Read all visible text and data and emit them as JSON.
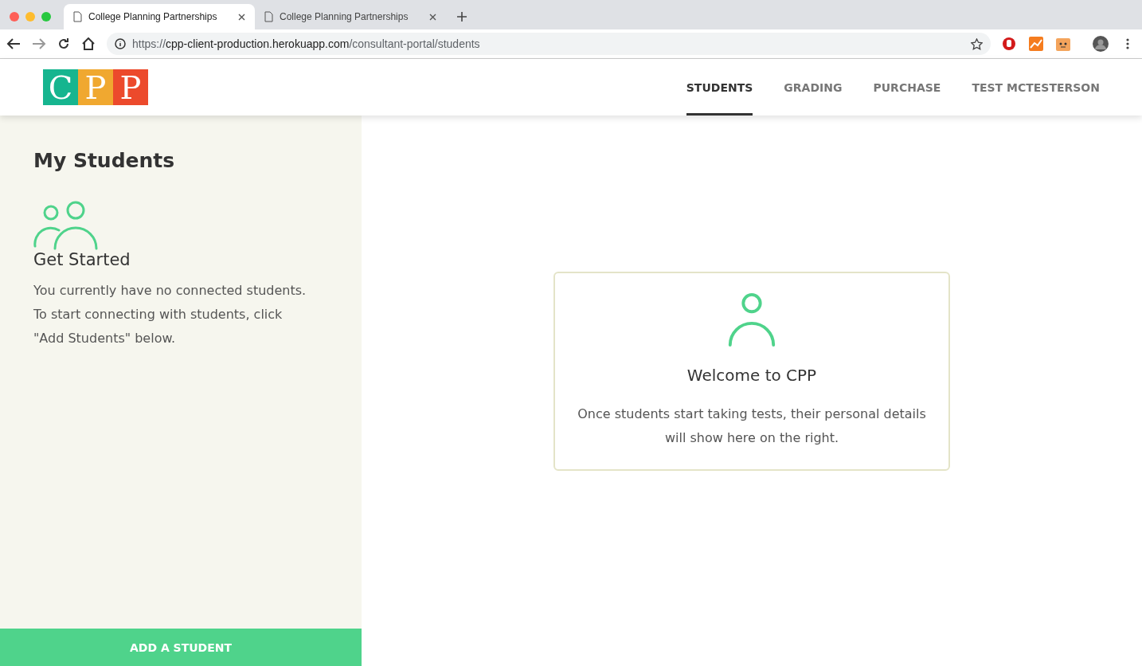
{
  "browser": {
    "tabs": [
      {
        "title": "College Planning Partnerships",
        "selected": true
      },
      {
        "title": "College Planning Partnerships",
        "selected": false
      }
    ],
    "address": {
      "scheme": "https://",
      "host": "cpp-client-production.herokuapp.com",
      "path": "/consultant-portal/students"
    }
  },
  "header": {
    "logo": [
      {
        "letter": "C",
        "color": "#16b58f"
      },
      {
        "letter": "P",
        "color": "#f0a830"
      },
      {
        "letter": "P",
        "color": "#ec4a2c"
      }
    ],
    "nav": [
      {
        "label": "STUDENTS",
        "selected": true
      },
      {
        "label": "GRADING",
        "selected": false
      },
      {
        "label": "PURCHASE",
        "selected": false
      },
      {
        "label": "TEST MCTESTERSON",
        "selected": false
      }
    ]
  },
  "sidebar": {
    "title": "My Students",
    "subtitle": "Get Started",
    "message": "You currently have no connected students. To start connecting with students, click \"Add Students\" below.",
    "button": "ADD A STUDENT"
  },
  "welcome": {
    "title": "Welcome to CPP",
    "message": "Once students start taking tests, their personal details will show here on the right."
  }
}
